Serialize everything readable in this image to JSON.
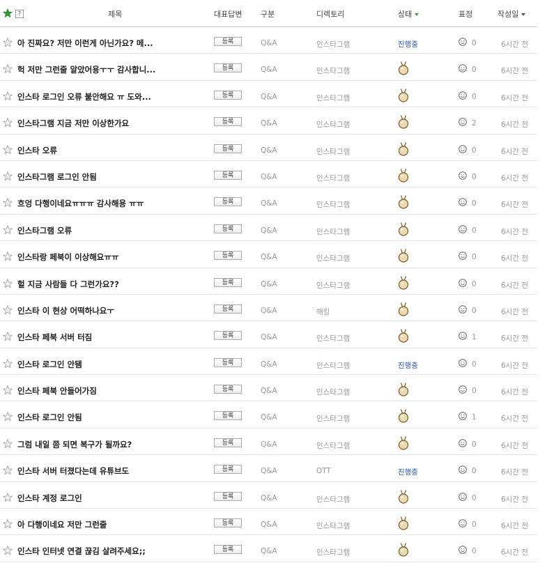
{
  "header": {
    "help": "?",
    "title": "제목",
    "rep_answer": "대표답변",
    "type": "구분",
    "directory": "디렉토리",
    "status": "상태",
    "reaction": "표정",
    "date": "작성일"
  },
  "colors": {
    "accent_green": "#3a9a3a",
    "status_link": "#2a56b5"
  },
  "rows": [
    {
      "title": "아 진짜요? 저만 이런게 아닌가요? 메...",
      "button": "등록",
      "type": "Q&A",
      "directory": "인스타그램",
      "status": "진행중",
      "status_icon": "",
      "reactions": "0",
      "date": "6시간 전"
    },
    {
      "title": "헉 저만 그런줄 알았어용ㅜㅜ 감사합니...",
      "button": "등록",
      "type": "Q&A",
      "directory": "인스타그램",
      "status": "",
      "status_icon": "medal-icon",
      "reactions": "0",
      "date": "6시간 전"
    },
    {
      "title": "인스타 로그인 오류 불안해요 ㅠ 도와...",
      "button": "등록",
      "type": "Q&A",
      "directory": "인스타그램",
      "status": "",
      "status_icon": "medal-icon",
      "reactions": "0",
      "date": "6시간 전"
    },
    {
      "title": "인스타그램 지금 저만 이상한가요",
      "button": "등록",
      "type": "Q&A",
      "directory": "인스타그램",
      "status": "",
      "status_icon": "medal-icon",
      "reactions": "2",
      "date": "6시간 전"
    },
    {
      "title": "인스타 오류",
      "button": "등록",
      "type": "Q&A",
      "directory": "인스타그램",
      "status": "",
      "status_icon": "medal-icon",
      "reactions": "0",
      "date": "6시간 전"
    },
    {
      "title": "인스타그램 로그인 안됨",
      "button": "등록",
      "type": "Q&A",
      "directory": "인스타그램",
      "status": "",
      "status_icon": "medal-icon",
      "reactions": "0",
      "date": "6시간 전"
    },
    {
      "title": "흐엉 다행이네요ㅠㅠㅠ 감사해용 ㅠㅠ",
      "button": "등록",
      "type": "Q&A",
      "directory": "인스타그램",
      "status": "",
      "status_icon": "medal-icon",
      "reactions": "0",
      "date": "6시간 전"
    },
    {
      "title": "인스타그램 오류",
      "button": "등록",
      "type": "Q&A",
      "directory": "인스타그램",
      "status": "",
      "status_icon": "medal-icon",
      "reactions": "0",
      "date": "6시간 전"
    },
    {
      "title": "인스타랑 페북이 이상해요ㅠㅠ",
      "button": "등록",
      "type": "Q&A",
      "directory": "인스타그램",
      "status": "",
      "status_icon": "medal-icon",
      "reactions": "0",
      "date": "6시간 전"
    },
    {
      "title": "헐 지금 사람들 다 그런가요??",
      "button": "등록",
      "type": "Q&A",
      "directory": "인스타그램",
      "status": "",
      "status_icon": "medal-icon",
      "reactions": "0",
      "date": "6시간 전"
    },
    {
      "title": "인스타 이 현상 어떡하나요ㅜ",
      "button": "등록",
      "type": "Q&A",
      "directory": "해킹",
      "status": "",
      "status_icon": "medal-icon",
      "reactions": "0",
      "date": "6시간 전"
    },
    {
      "title": "인스타 페북 서버 터짐",
      "button": "등록",
      "type": "Q&A",
      "directory": "인스타그램",
      "status": "",
      "status_icon": "medal-icon",
      "reactions": "1",
      "date": "6시간 전"
    },
    {
      "title": "인스타 로그인 안됌",
      "button": "등록",
      "type": "Q&A",
      "directory": "인스타그램",
      "status": "진행중",
      "status_icon": "",
      "reactions": "0",
      "date": "6시간 전"
    },
    {
      "title": "인스타 페북 안들어가짐",
      "button": "등록",
      "type": "Q&A",
      "directory": "인스타그램",
      "status": "",
      "status_icon": "medal-icon",
      "reactions": "0",
      "date": "6시간 전"
    },
    {
      "title": "인스타 로그인 안됨",
      "button": "등록",
      "type": "Q&A",
      "directory": "인스타그램",
      "status": "",
      "status_icon": "medal-icon",
      "reactions": "1",
      "date": "6시간 전"
    },
    {
      "title": "그럼 내일 쯤 되면 복구가 될까요?",
      "button": "등록",
      "type": "Q&A",
      "directory": "인스타그램",
      "status": "",
      "status_icon": "medal-icon",
      "reactions": "0",
      "date": "6시간 전"
    },
    {
      "title": "인스타 서버 터졌다는데 유튜브도",
      "button": "등록",
      "type": "Q&A",
      "directory": "OTT",
      "status": "진행중",
      "status_icon": "",
      "reactions": "0",
      "date": "6시간 전"
    },
    {
      "title": "인스타 계정 로그인",
      "button": "등록",
      "type": "Q&A",
      "directory": "인스타그램",
      "status": "",
      "status_icon": "medal-icon",
      "reactions": "0",
      "date": "6시간 전"
    },
    {
      "title": "아 다행이네요 저만 그런줄",
      "button": "등록",
      "type": "Q&A",
      "directory": "인스타그램",
      "status": "",
      "status_icon": "medal-icon",
      "reactions": "0",
      "date": "6시간 전"
    },
    {
      "title": "인스타 인터넷 연결 끊김 살려주세요;;",
      "button": "등록",
      "type": "Q&A",
      "directory": "인스타그램",
      "status": "",
      "status_icon": "medal-icon",
      "reactions": "0",
      "date": "6시간 전"
    }
  ]
}
